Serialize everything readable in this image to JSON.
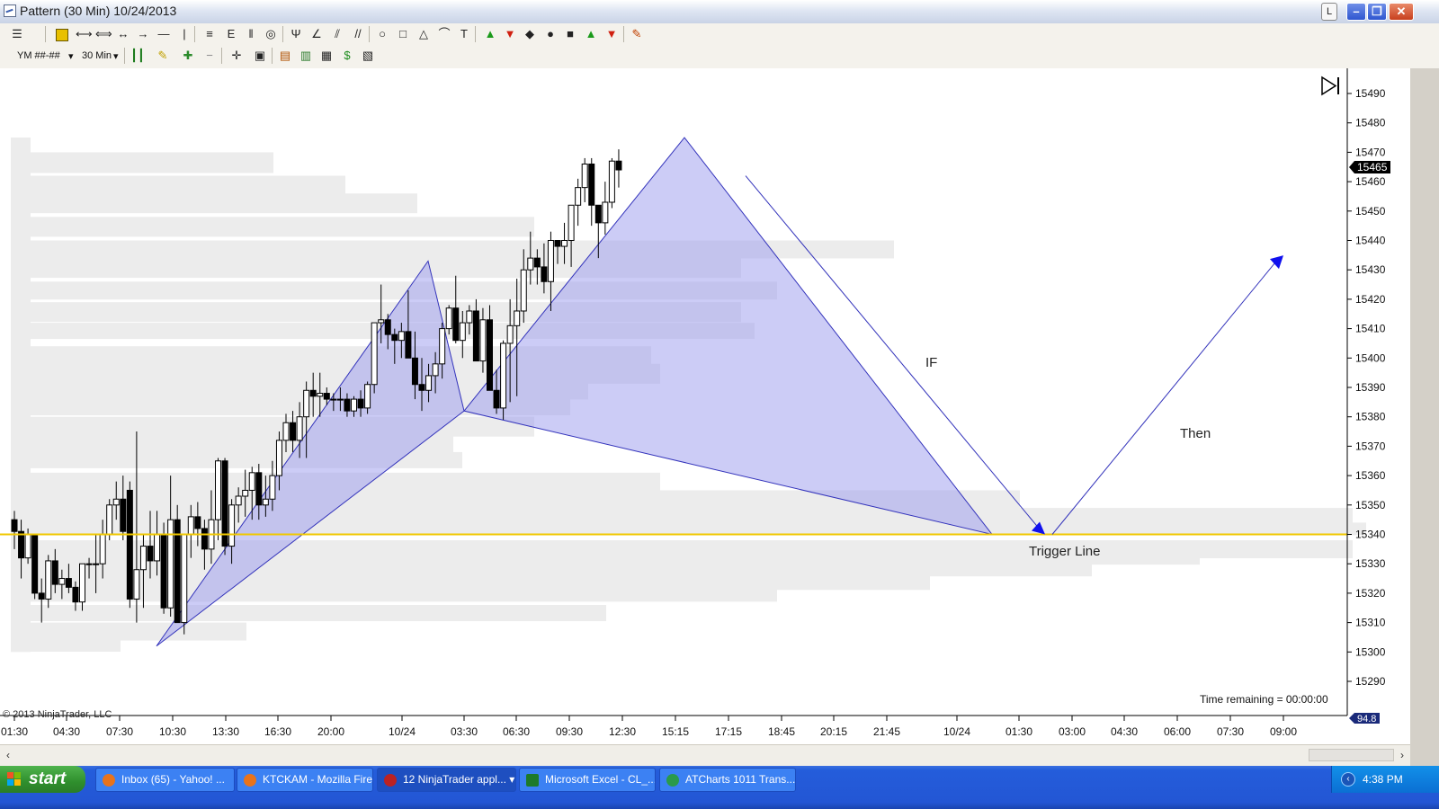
{
  "window": {
    "title": "Pattern (30 Min)  10/24/2013",
    "lbtn": "L",
    "min": "–",
    "max": "❐",
    "close": "✕"
  },
  "toolbar1_icons": [
    "menu-icon",
    "label-icon",
    "line-icon",
    "ray-icon",
    "extended-line-icon",
    "arrow-line-icon",
    "horizontal-line-icon",
    "vertical-line-icon",
    "fib-retracement-icon",
    "fib-extension-icon",
    "fib-timezone-icon",
    "fib-circle-icon",
    "andrews-pitchfork-icon",
    "gann-fan-icon",
    "regression-channel-icon",
    "trend-channel-icon",
    "ellipse-icon",
    "rectangle-icon",
    "triangle-icon",
    "arc-icon",
    "text-icon",
    "arrow-up-icon",
    "arrow-down-icon",
    "diamond-icon",
    "dot-icon",
    "square-icon",
    "triangle-up-icon",
    "triangle-down-icon",
    "ruler-icon"
  ],
  "toolbar2": {
    "instrument": "YM ##-##",
    "interval": "30 Min"
  },
  "copyright": "© 2013 NinjaTrader, LLC",
  "time_remaining": "Time remaining = 00:00:00",
  "price_tag": "15465",
  "bottom_tag": "94.8",
  "annotations": {
    "if": "IF",
    "then": "Then",
    "trigger": "Trigger Line"
  },
  "y_labels": [
    "15490",
    "15480",
    "15470",
    "15460",
    "15450",
    "15440",
    "15430",
    "15420",
    "15410",
    "15400",
    "15390",
    "15380",
    "15370",
    "15360",
    "15350",
    "15340",
    "15330",
    "15320",
    "15310",
    "15300",
    "15290"
  ],
  "x_labels": [
    "01:30",
    "04:30",
    "07:30",
    "10:30",
    "13:30",
    "16:30",
    "20:00",
    "10/24",
    "03:30",
    "06:30",
    "09:30",
    "12:30",
    "15:15",
    "17:15",
    "18:45",
    "20:15",
    "21:45",
    "10/24",
    "01:30",
    "03:00",
    "04:30",
    "06:00",
    "07:30",
    "09:00"
  ],
  "candles": [
    [
      15345,
      15348,
      15335,
      15341
    ],
    [
      15341,
      15345,
      15325,
      15332
    ],
    [
      15332,
      15342,
      15330,
      15340
    ],
    [
      15340,
      15340,
      15318,
      15320
    ],
    [
      15320,
      15325,
      15310,
      15318
    ],
    [
      15318,
      15333,
      15315,
      15331
    ],
    [
      15331,
      15335,
      15320,
      15323
    ],
    [
      15323,
      15328,
      15318,
      15325
    ],
    [
      15325,
      15330,
      15320,
      15322
    ],
    [
      15322,
      15324,
      15314,
      15317
    ],
    [
      15317,
      15330,
      15314,
      15330
    ],
    [
      15330,
      15332,
      15325,
      15330
    ],
    [
      15330,
      15340,
      15320,
      15330
    ],
    [
      15330,
      15345,
      15325,
      15340
    ],
    [
      15340,
      15352,
      15338,
      15350
    ],
    [
      15350,
      15358,
      15345,
      15352
    ],
    [
      15352,
      15360,
      15338,
      15341
    ],
    [
      15355,
      15358,
      15315,
      15318
    ],
    [
      15318,
      15375,
      15310,
      15328
    ],
    [
      15328,
      15340,
      15315,
      15336
    ],
    [
      15336,
      15348,
      15325,
      15331
    ],
    [
      15331,
      15348,
      15326,
      15340
    ],
    [
      15340,
      15344,
      15313,
      15315
    ],
    [
      15315,
      15360,
      15312,
      15345
    ],
    [
      15345,
      15350,
      15328,
      15310
    ],
    [
      15310,
      15325,
      15306,
      15340
    ],
    [
      15340,
      15350,
      15332,
      15346
    ],
    [
      15346,
      15351,
      15336,
      15342
    ],
    [
      15342,
      15345,
      15328,
      15335
    ],
    [
      15335,
      15355,
      15330,
      15345
    ],
    [
      15345,
      15366,
      15338,
      15365
    ],
    [
      15365,
      15366,
      15333,
      15336
    ],
    [
      15336,
      15352,
      15330,
      15350
    ],
    [
      15350,
      15356,
      15344,
      15353
    ],
    [
      15353,
      15362,
      15346,
      15355
    ],
    [
      15355,
      15363,
      15345,
      15361
    ],
    [
      15361,
      15364,
      15345,
      15350
    ],
    [
      15350,
      15360,
      15346,
      15352
    ],
    [
      15352,
      15365,
      15348,
      15360
    ],
    [
      15360,
      15375,
      15355,
      15372
    ],
    [
      15372,
      15381,
      15368,
      15378
    ],
    [
      15378,
      15382,
      15368,
      15372
    ],
    [
      15372,
      15385,
      15366,
      15380
    ],
    [
      15380,
      15392,
      15366,
      15389
    ],
    [
      15389,
      15395,
      15380,
      15387
    ],
    [
      15387,
      15395,
      15380,
      15388
    ],
    [
      15388,
      15390,
      15384,
      15386
    ],
    [
      15386,
      15388,
      15382,
      15386
    ],
    [
      15386,
      15390,
      15382,
      15386
    ],
    [
      15386,
      15388,
      15380,
      15382
    ],
    [
      15382,
      15387,
      15380,
      15386
    ],
    [
      15386,
      15389,
      15380,
      15383
    ],
    [
      15383,
      15392,
      15381,
      15391
    ],
    [
      15391,
      15412,
      15388,
      15412
    ],
    [
      15412,
      15425,
      15405,
      15413
    ],
    [
      15413,
      15415,
      15403,
      15408
    ],
    [
      15408,
      15410,
      15398,
      15406
    ],
    [
      15406,
      15412,
      15400,
      15409
    ],
    [
      15409,
      15423,
      15403,
      15400
    ],
    [
      15400,
      15409,
      15386,
      15391
    ],
    [
      15391,
      15400,
      15382,
      15389
    ],
    [
      15389,
      15398,
      15385,
      15394
    ],
    [
      15394,
      15402,
      15388,
      15398
    ],
    [
      15398,
      15412,
      15393,
      15410
    ],
    [
      15410,
      15418,
      15408,
      15417
    ],
    [
      15417,
      15428,
      15405,
      15406
    ],
    [
      15406,
      15416,
      15400,
      15412
    ],
    [
      15412,
      15418,
      15408,
      15416
    ],
    [
      15416,
      15420,
      15401,
      15399
    ],
    [
      15399,
      15417,
      15395,
      15413
    ],
    [
      15413,
      15418,
      15390,
      15389
    ],
    [
      15389,
      15396,
      15381,
      15383
    ],
    [
      15383,
      15406,
      15379,
      15405
    ],
    [
      15405,
      15420,
      15385,
      15411
    ],
    [
      15411,
      15427,
      15387,
      15416
    ],
    [
      15416,
      15437,
      15412,
      15430
    ],
    [
      15430,
      15443,
      15425,
      15434
    ],
    [
      15434,
      15437,
      15425,
      15431
    ],
    [
      15431,
      15439,
      15422,
      15426
    ],
    [
      15426,
      15443,
      15416,
      15440
    ],
    [
      15440,
      15440,
      15432,
      15438
    ],
    [
      15438,
      15446,
      15432,
      15440
    ],
    [
      15440,
      15451,
      15431,
      15452
    ],
    [
      15452,
      15461,
      15445,
      15458
    ],
    [
      15458,
      15468,
      15453,
      15466
    ],
    [
      15466,
      15468,
      15445,
      15452
    ],
    [
      15452,
      15452,
      15434,
      15446
    ],
    [
      15446,
      15460,
      15442,
      15453
    ],
    [
      15453,
      15468,
      15451,
      15467
    ],
    [
      15467,
      15471,
      15458,
      15464
    ]
  ]
}
